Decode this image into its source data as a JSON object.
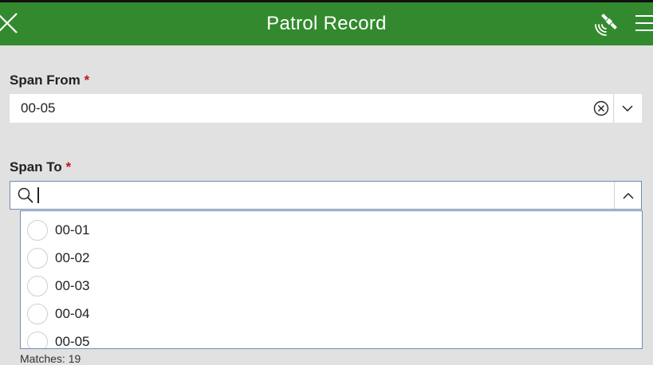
{
  "header": {
    "title": "Patrol Record",
    "close_icon": "close-icon",
    "gps_icon": "satellite-icon",
    "menu_icon": "hamburger-menu-icon",
    "bg_color": "#338a2e"
  },
  "span_from": {
    "label": "Span From",
    "required_marker": "*",
    "value": "00-05"
  },
  "span_to": {
    "label": "Span To",
    "required_marker": "*",
    "search_value": "",
    "options": [
      "00-01",
      "00-02",
      "00-03",
      "00-04",
      "00-05"
    ]
  },
  "matches": "Matches: 19"
}
